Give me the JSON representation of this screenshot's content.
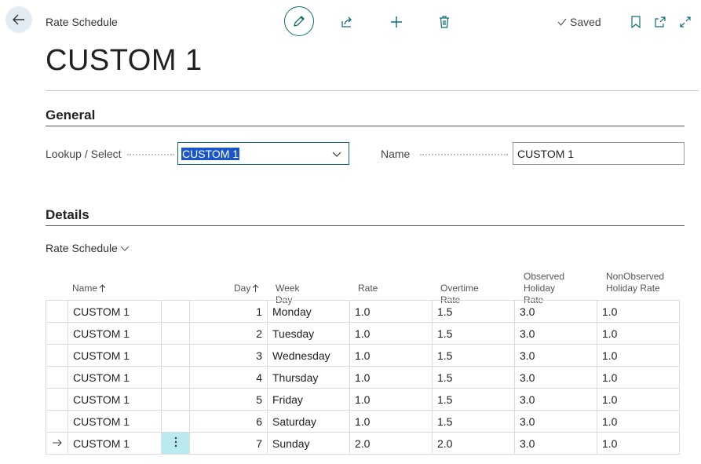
{
  "header": {
    "breadcrumb": "Rate Schedule",
    "saved_label": "Saved",
    "title": "CUSTOM 1"
  },
  "general": {
    "section_title": "General",
    "lookup_label": "Lookup / Select",
    "lookup_value": "CUSTOM 1",
    "name_label": "Name",
    "name_value": "CUSTOM 1"
  },
  "details": {
    "section_title": "Details",
    "subpage_menu": "Rate Schedule",
    "columns": {
      "name": "Name",
      "day": "Day",
      "week_day": "Week Day",
      "rate": "Rate",
      "overtime_rate": "Overtime Rate",
      "observed_1": "Observed",
      "observed_2": "Holiday Rate",
      "nonobserved_1": "NonObserved",
      "nonobserved_2": "Holiday Rate"
    },
    "rows": [
      {
        "name": "CUSTOM 1",
        "day": "1",
        "week_day": "Monday",
        "rate": "1.0",
        "overtime": "1.5",
        "observed": "3.0",
        "nonobserved": "1.0"
      },
      {
        "name": "CUSTOM 1",
        "day": "2",
        "week_day": "Tuesday",
        "rate": "1.0",
        "overtime": "1.5",
        "observed": "3.0",
        "nonobserved": "1.0"
      },
      {
        "name": "CUSTOM 1",
        "day": "3",
        "week_day": "Wednesday",
        "rate": "1.0",
        "overtime": "1.5",
        "observed": "3.0",
        "nonobserved": "1.0"
      },
      {
        "name": "CUSTOM 1",
        "day": "4",
        "week_day": "Thursday",
        "rate": "1.0",
        "overtime": "1.5",
        "observed": "3.0",
        "nonobserved": "1.0"
      },
      {
        "name": "CUSTOM 1",
        "day": "5",
        "week_day": "Friday",
        "rate": "1.0",
        "overtime": "1.5",
        "observed": "3.0",
        "nonobserved": "1.0"
      },
      {
        "name": "CUSTOM 1",
        "day": "6",
        "week_day": "Saturday",
        "rate": "1.0",
        "overtime": "1.5",
        "observed": "3.0",
        "nonobserved": "1.0"
      },
      {
        "name": "CUSTOM 1",
        "day": "7",
        "week_day": "Sunday",
        "rate": "2.0",
        "overtime": "2.0",
        "observed": "3.0",
        "nonobserved": "1.0"
      }
    ]
  },
  "icons": {
    "back": "arrow-left-icon",
    "edit": "pencil-icon",
    "share": "share-icon",
    "new": "plus-icon",
    "delete": "trash-icon",
    "saved": "checkmark-icon",
    "bookmark": "bookmark-icon",
    "open_new_window": "open-new-window-icon",
    "expand": "expand-icon",
    "current_row": "arrow-right-icon",
    "row_actions": "more-vertical-icon",
    "sort_ascending": "arrow-up-icon",
    "dropdown": "chevron-down-icon"
  },
  "colors": {
    "accent": "#0f6d73",
    "selection": "#1a56c9",
    "active_cell": "#b9eaf0"
  }
}
